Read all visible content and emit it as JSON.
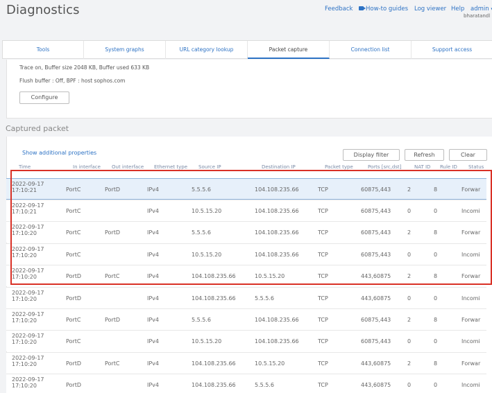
{
  "header": {
    "title": "Diagnostics",
    "links": [
      "Feedback",
      "How-to guides",
      "Log viewer",
      "Help",
      "admin"
    ],
    "username": "bharatandl"
  },
  "tabs": [
    "Tools",
    "System graphs",
    "URL category lookup",
    "Packet capture",
    "Connection list",
    "Support access"
  ],
  "active_tab": "Packet capture",
  "config": {
    "trace": "Trace on, Buffer size 2048 KB, Buffer used 633 KB",
    "flush": "Flush buffer : Off, BPF : host sophos.com",
    "configure_label": "Configure"
  },
  "captured": {
    "title": "Captured packet",
    "show_more": "Show additional properties",
    "display_filter": "Display filter",
    "refresh": "Refresh",
    "clear": "Clear"
  },
  "columns": [
    "Time",
    "In interface",
    "Out interface",
    "Ethernet type",
    "Source IP",
    "Destination IP",
    "Packet type",
    "Ports [src,dst]",
    "NAT ID",
    "Rule ID",
    "Status"
  ],
  "rows": [
    {
      "date": "2022-09-17",
      "time": "17:10:21",
      "in": "PortC",
      "out": "PortD",
      "eth": "IPv4",
      "src": "5.5.5.6",
      "dst": "104.108.235.66",
      "ptype": "TCP",
      "ports": "60875,443",
      "nat": "2",
      "rule": "8",
      "status": "Forwar"
    },
    {
      "date": "2022-09-17",
      "time": "17:10:21",
      "in": "PortC",
      "out": "",
      "eth": "IPv4",
      "src": "10.5.15.20",
      "dst": "104.108.235.66",
      "ptype": "TCP",
      "ports": "60875,443",
      "nat": "0",
      "rule": "0",
      "status": "Incomi"
    },
    {
      "date": "2022-09-17",
      "time": "17:10:20",
      "in": "PortC",
      "out": "PortD",
      "eth": "IPv4",
      "src": "5.5.5.6",
      "dst": "104.108.235.66",
      "ptype": "TCP",
      "ports": "60875,443",
      "nat": "2",
      "rule": "8",
      "status": "Forwar"
    },
    {
      "date": "2022-09-17",
      "time": "17:10:20",
      "in": "PortC",
      "out": "",
      "eth": "IPv4",
      "src": "10.5.15.20",
      "dst": "104.108.235.66",
      "ptype": "TCP",
      "ports": "60875,443",
      "nat": "0",
      "rule": "0",
      "status": "Incomi"
    },
    {
      "date": "2022-09-17",
      "time": "17:10:20",
      "in": "PortD",
      "out": "PortC",
      "eth": "IPv4",
      "src": "104.108.235.66",
      "dst": "10.5.15.20",
      "ptype": "TCP",
      "ports": "443,60875",
      "nat": "2",
      "rule": "8",
      "status": "Forwar"
    },
    {
      "date": "2022-09-17",
      "time": "17:10:20",
      "in": "PortD",
      "out": "",
      "eth": "IPv4",
      "src": "104.108.235.66",
      "dst": "5.5.5.6",
      "ptype": "TCP",
      "ports": "443,60875",
      "nat": "0",
      "rule": "0",
      "status": "Incomi"
    },
    {
      "date": "2022-09-17",
      "time": "17:10:20",
      "in": "PortC",
      "out": "PortD",
      "eth": "IPv4",
      "src": "5.5.5.6",
      "dst": "104.108.235.66",
      "ptype": "TCP",
      "ports": "60875,443",
      "nat": "2",
      "rule": "8",
      "status": "Forwar"
    },
    {
      "date": "2022-09-17",
      "time": "17:10:20",
      "in": "PortC",
      "out": "",
      "eth": "IPv4",
      "src": "10.5.15.20",
      "dst": "104.108.235.66",
      "ptype": "TCP",
      "ports": "60875,443",
      "nat": "0",
      "rule": "0",
      "status": "Incomi"
    },
    {
      "date": "2022-09-17",
      "time": "17:10:20",
      "in": "PortD",
      "out": "PortC",
      "eth": "IPv4",
      "src": "104.108.235.66",
      "dst": "10.5.15.20",
      "ptype": "TCP",
      "ports": "443,60875",
      "nat": "2",
      "rule": "8",
      "status": "Forwar"
    },
    {
      "date": "2022-09-17",
      "time": "17:10:20",
      "in": "PortD",
      "out": "",
      "eth": "IPv4",
      "src": "104.108.235.66",
      "dst": "5.5.5.6",
      "ptype": "TCP",
      "ports": "443,60875",
      "nat": "0",
      "rule": "0",
      "status": "Incomi"
    }
  ],
  "selected_row": 0,
  "colors": {
    "accent": "#2d72c4",
    "highlight": "#d93025",
    "selected_bg": "#e7f0fa"
  }
}
